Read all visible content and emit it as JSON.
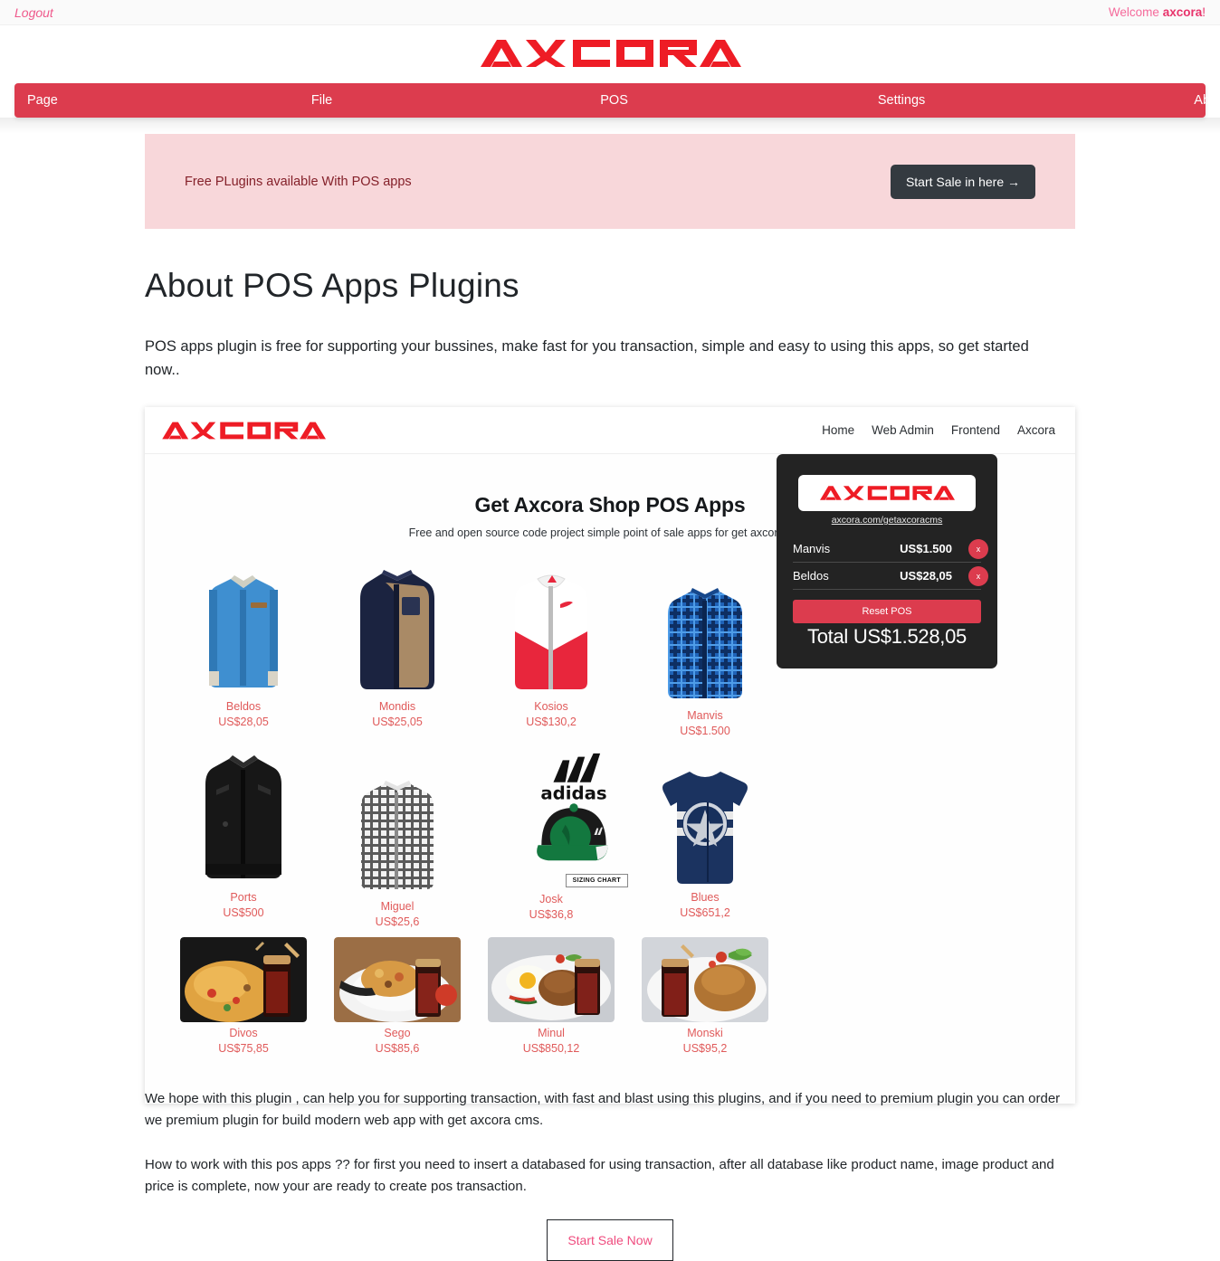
{
  "topbar": {
    "logout_label": "Logout",
    "welcome_prefix": "Welcome ",
    "welcome_user": "axcora",
    "welcome_suffix": "!"
  },
  "brand": {
    "name": "AXCORA"
  },
  "nav": {
    "items": [
      {
        "label": "Page"
      },
      {
        "label": "File"
      },
      {
        "label": "POS"
      },
      {
        "label": "Settings"
      },
      {
        "label": "About"
      }
    ]
  },
  "promo": {
    "text": "Free PLugins available With POS apps",
    "button_label": "Start Sale in here →"
  },
  "page": {
    "title": "About POS Apps Plugins",
    "lede": "POS apps plugin is free for supporting your bussines, make fast for you transaction, simple and easy to using this apps, so get started now.."
  },
  "screenshot": {
    "brand": "AXCORA",
    "nav_links": [
      "Home",
      "Web Admin",
      "Frontend",
      "Axcora"
    ],
    "hero_title": "Get Axcora Shop POS Apps",
    "hero_subtitle": "Free and open source code project simple point of sale apps for get axcora cms.",
    "cart": {
      "logo": "AXCORA",
      "url": "axcora.com/getaxcoracms",
      "remove_label": "x",
      "items": [
        {
          "name": "Manvis",
          "price": "US$1.500"
        },
        {
          "name": "Beldos",
          "price": "US$28,05"
        }
      ],
      "reset_label": "Reset POS",
      "total_label": "Total US$1.528,05"
    },
    "products": [
      [
        {
          "name": "Beldos",
          "price": "US$28,05",
          "kind": "shirt-blue"
        },
        {
          "name": "Mondis",
          "price": "US$25,05",
          "kind": "jacket-navy-tan"
        },
        {
          "name": "Kosios",
          "price": "US$130,2",
          "kind": "hoodie-red-white"
        },
        {
          "name": "Manvis",
          "price": "US$1.500",
          "kind": "shirt-plaid-blue"
        }
      ],
      [
        {
          "name": "Ports",
          "price": "US$500",
          "kind": "jacket-leather-black"
        },
        {
          "name": "Miguel",
          "price": "US$25,6",
          "kind": "shirt-check-grey"
        },
        {
          "name": "Josk",
          "price": "US$36,8",
          "kind": "cap-adidas-green"
        },
        {
          "name": "Blues",
          "price": "US$651,2",
          "kind": "tshirt-captain-navy"
        }
      ],
      [
        {
          "name": "Divos",
          "price": "US$75,85",
          "kind": "food-friedrice-dark"
        },
        {
          "name": "Sego",
          "price": "US$85,6",
          "kind": "food-noodles-plate"
        },
        {
          "name": "Minul",
          "price": "US$850,12",
          "kind": "food-egg-rice"
        },
        {
          "name": "Monski",
          "price": "US$95,2",
          "kind": "food-rice-cola"
        }
      ]
    ],
    "cap_badge": "SIZING CHART",
    "cap_brand": "adidas"
  },
  "footer_text": {
    "para1": "We hope with this plugin , can help you for supporting transaction, with fast and blast using this plugins, and if you need to premium plugin you can order we premium plugin for build modern web app with get axcora cms.",
    "para2": "How to work with this pos apps ?? for first you need to insert a databased for using transaction, after all database like product name, image product and price is complete, now your are ready to create pos transaction.",
    "cta_label": "Start Sale Now"
  },
  "colors": {
    "brand_red": "#dc3c4e",
    "logo_red": "#ee1c25",
    "pink": "#ef5a8c",
    "promo_bg": "#f8d7da",
    "dark": "#343a40",
    "product_label": "#e05a5a"
  }
}
